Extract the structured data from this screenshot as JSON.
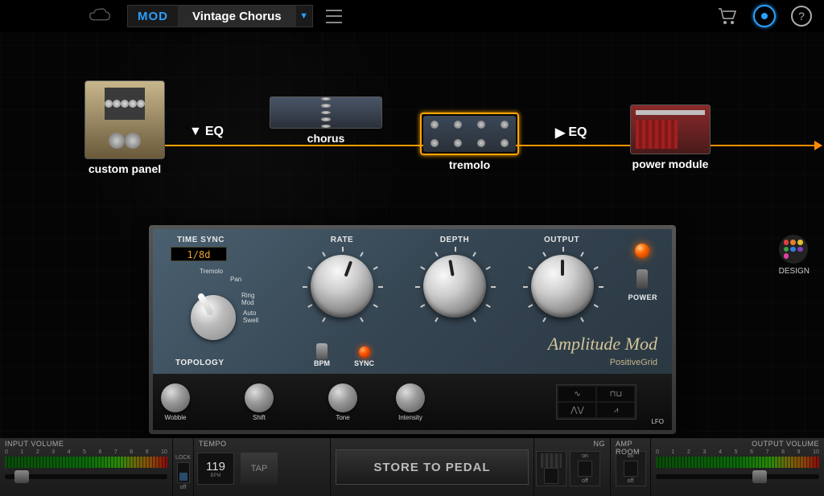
{
  "header": {
    "preset_type": "MOD",
    "preset_name": "Vintage Chorus"
  },
  "chain": {
    "custom_panel": "custom panel",
    "eq1": "EQ",
    "chorus": "chorus",
    "tremolo": "tremolo",
    "eq2": "EQ",
    "power_module": "power module"
  },
  "design_label": "DESIGN",
  "panel": {
    "time_sync_label": "TIME SYNC",
    "time_sync_value": "1/8d",
    "topology_label": "TOPOLOGY",
    "topology_options": [
      "Tremolo",
      "Pan",
      "Ring Mod",
      "Auto Swell"
    ],
    "rate_label": "RATE",
    "depth_label": "DEPTH",
    "output_label": "OUTPUT",
    "bpm_label": "BPM",
    "sync_label": "SYNC",
    "power_label": "POWER",
    "brand_script": "Amplitude Mod",
    "brand_sub": "PositiveGrid",
    "bottom_knobs": [
      "Wobble",
      "Shift",
      "Tone",
      "Intensity"
    ],
    "lfo_label": "LFO"
  },
  "bottombar": {
    "input_label": "INPUT VOLUME",
    "tempo_label": "TEMPO",
    "ng_label": "NG",
    "amp_label": "AMP ROOM",
    "output_label": "OUTPUT VOLUME",
    "lock_top": "LOCK",
    "lock_bot": "off",
    "tempo_value": "119",
    "tempo_unit": "BPM",
    "tap": "TAP",
    "store": "STORE TO PEDAL",
    "on": "on",
    "off": "off",
    "scale": [
      "0",
      "1",
      "2",
      "3",
      "4",
      "5",
      "6",
      "7",
      "8",
      "9",
      "10"
    ]
  }
}
